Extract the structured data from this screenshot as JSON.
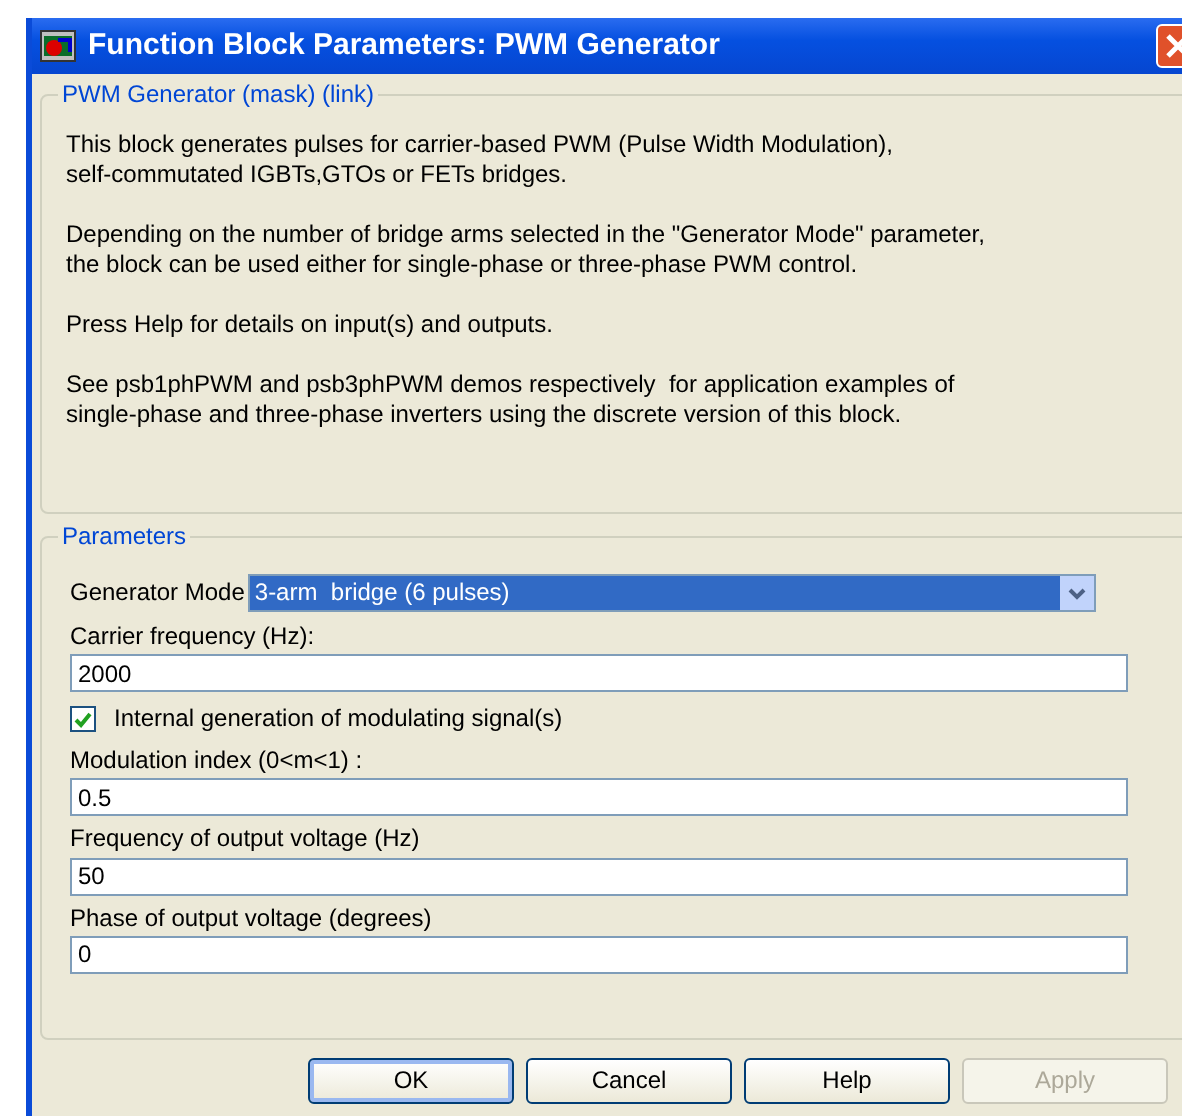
{
  "window": {
    "title": "Function Block Parameters: PWM Generator"
  },
  "description": {
    "legend": "PWM Generator (mask) (link)",
    "paragraphs": [
      "This block generates pulses for carrier-based PWM (Pulse Width Modulation),\nself-commutated IGBTs,GTOs or FETs bridges.",
      "Depending on the number of bridge arms selected in the \"Generator Mode\" parameter,\nthe block can be used either for single-phase or three-phase PWM control.",
      "Press Help for details on input(s) and outputs.",
      "See psb1phPWM and psb3phPWM demos respectively  for application examples of\nsingle-phase and three-phase inverters using the discrete version of this block."
    ]
  },
  "parameters": {
    "legend": "Parameters",
    "items": [
      {
        "kind": "dropdown",
        "label": "Generator Mode",
        "value": "3-arm  bridge (6 pulses)"
      },
      {
        "kind": "text",
        "label": "Carrier frequency (Hz):",
        "value": "2000"
      },
      {
        "kind": "checkbox",
        "label": "Internal generation of modulating signal(s)",
        "checked": true
      },
      {
        "kind": "text",
        "label": "Modulation index  (0<m<1) :",
        "value": "0.5"
      },
      {
        "kind": "text",
        "label": "Frequency of output voltage (Hz)",
        "value": "50"
      },
      {
        "kind": "text",
        "label": "Phase of output voltage (degrees)",
        "value": "0"
      }
    ]
  },
  "buttons": [
    {
      "label": "OK",
      "disabled": false
    },
    {
      "label": "Cancel",
      "disabled": false
    },
    {
      "label": "Help",
      "disabled": false
    },
    {
      "label": "Apply",
      "disabled": true
    }
  ]
}
